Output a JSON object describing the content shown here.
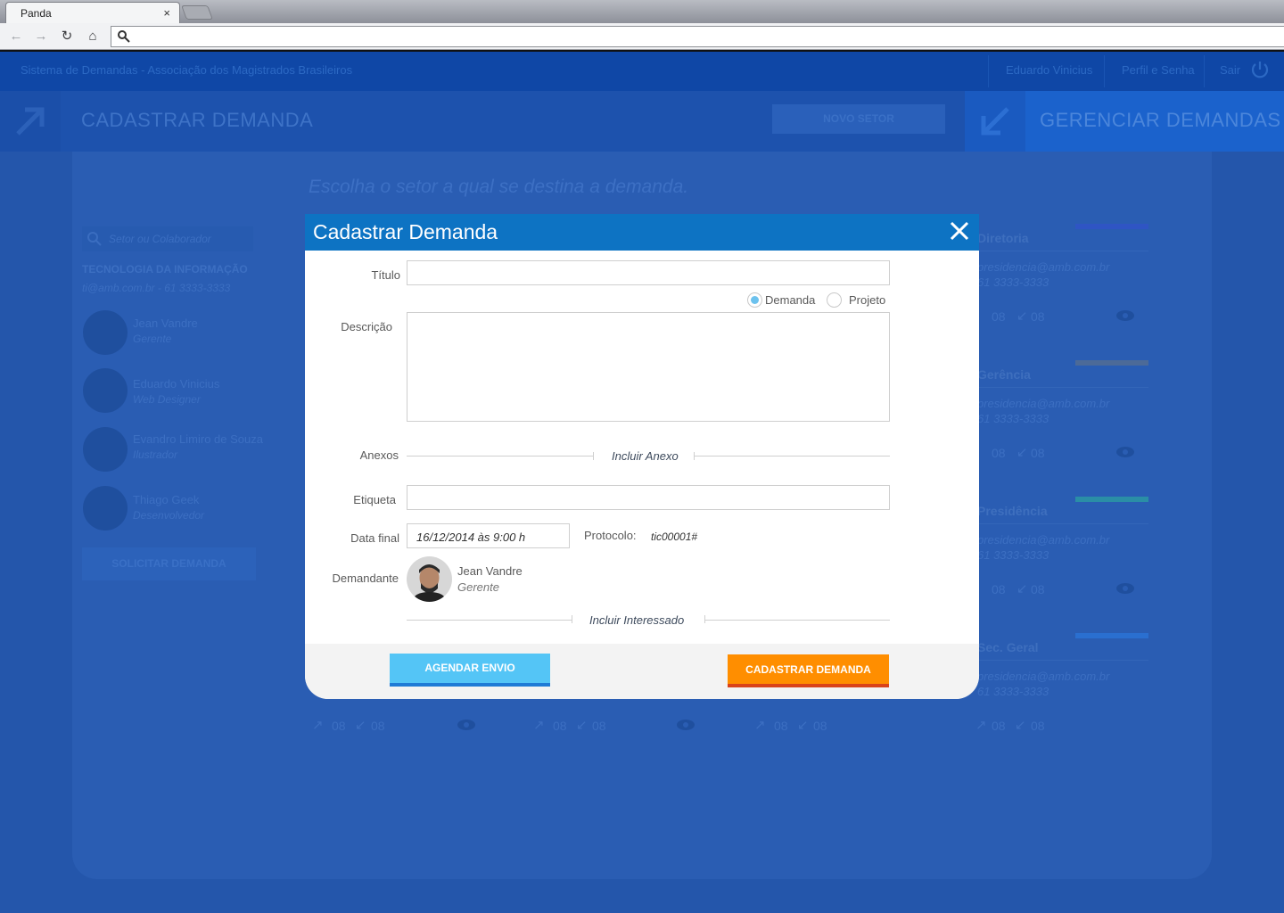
{
  "browser": {
    "tab_title": "Panda",
    "tab_close": "×",
    "nav_back": "←",
    "nav_forward": "→",
    "nav_reload": "↻",
    "nav_home": "⌂",
    "address": ""
  },
  "app": {
    "system_title": "Sistema de Demandas - Associação dos Magistrados Brasileiros",
    "user_name": "Eduardo Vinicius",
    "profile_link": "Perfil e Senha",
    "logout_link": "Sair"
  },
  "sections": {
    "cadastrar_title": "CADASTRAR DEMANDA",
    "novo_setor": "NOVO SETOR",
    "gerenciar_title": "GERENCIAR DEMANDAS"
  },
  "background": {
    "choose_sector": "Escolha o setor a qual se destina a demanda.",
    "search_placeholder": "Setor ou Colaborador",
    "department": "TECNOLOGIA DA INFORMAÇÃO",
    "department_contact": "ti@amb.com.br - 61 3333-3333",
    "people": [
      {
        "name": "Jean Vandre",
        "role": "Gerente"
      },
      {
        "name": "Eduardo Vinicius",
        "role": "Web Designer"
      },
      {
        "name": "Evandro Limiro de Souza",
        "role": "Ilustrador"
      },
      {
        "name": "Thiago Geek",
        "role": "Desenvolvedor"
      }
    ],
    "solicitar": "SOLICITAR DEMANDA",
    "sector_cards": [
      {
        "name": "Diretoria",
        "email": "presidencia@amb.com.br",
        "phone": "61 3333-3333",
        "out": "08",
        "in": "08",
        "color": "#2f55c4"
      },
      {
        "name": "Gerência",
        "email": "presidencia@amb.com.br",
        "phone": "61 3333-3333",
        "out": "08",
        "in": "08",
        "color": "#4c6a98"
      },
      {
        "name": "Presidência",
        "email": "presidencia@amb.com.br",
        "phone": "61 3333-3333",
        "out": "08",
        "in": "08",
        "color": "#2a8ea6"
      },
      {
        "name": "Sec. Geral",
        "email": "presidencia@amb.com.br",
        "phone": "61 3333-3333",
        "out": "08",
        "in": "08",
        "color": "#2a6fd0"
      }
    ],
    "bottom_counts": [
      "08",
      "08"
    ]
  },
  "modal": {
    "title": "Cadastrar Demanda",
    "labels": {
      "titulo": "Título",
      "descricao": "Descrição",
      "anexos": "Anexos",
      "etiqueta": "Etiqueta",
      "data_final": "Data final",
      "demandante": "Demandante",
      "protocolo": "Protocolo:"
    },
    "type_options": [
      {
        "label": "Demanda",
        "selected": true
      },
      {
        "label": "Projeto",
        "selected": false
      }
    ],
    "values": {
      "titulo": "",
      "descricao": "",
      "etiqueta": "",
      "data_final": "16/12/2014 às 9:00 h",
      "protocolo": "tic00001#"
    },
    "links": {
      "incluir_anexo": "Incluir Anexo",
      "incluir_interessado": "Incluir Interessado"
    },
    "requester": {
      "name": "Jean Vandre",
      "role": "Gerente"
    },
    "buttons": {
      "agendar": "AGENDAR ENVIO",
      "cadastrar": "CADASTRAR  DEMANDA"
    },
    "colors": {
      "header": "#0d73c3",
      "agendar": "#54c5f6",
      "cadastrar": "#ff8e00"
    }
  }
}
